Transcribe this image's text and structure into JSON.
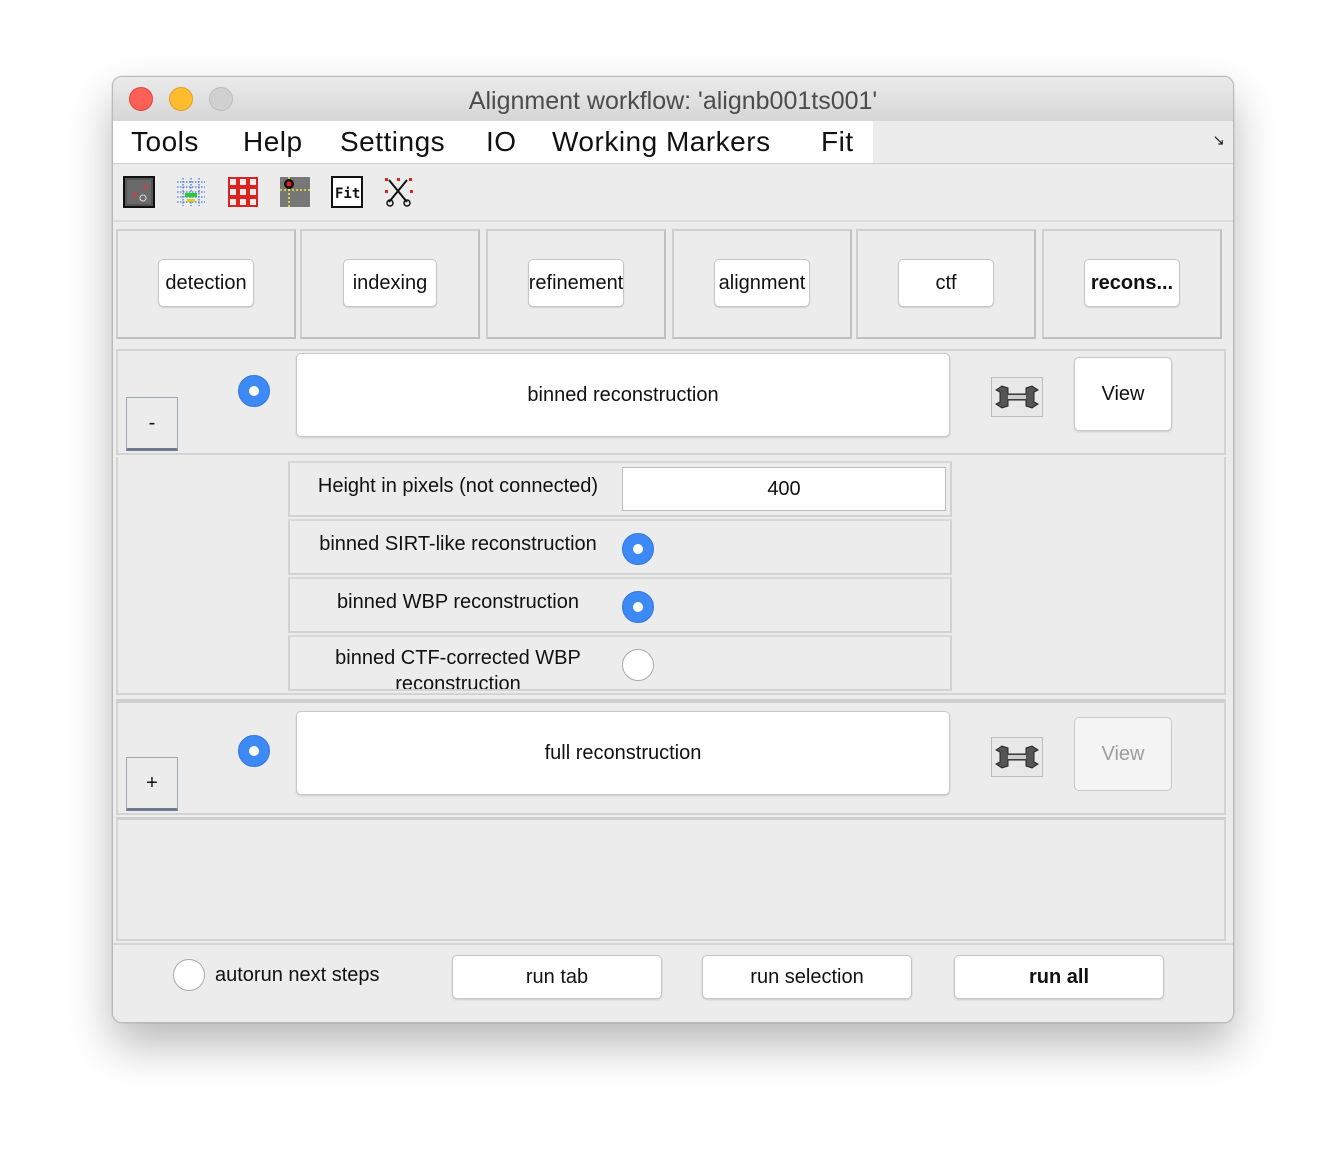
{
  "window": {
    "title": "Alignment workflow: 'alignb001ts001'"
  },
  "menu": {
    "items": [
      "Tools",
      "Help",
      "Settings",
      "IO",
      "Working Markers",
      "Fit"
    ],
    "overflow_icon": "resize-arrow-icon"
  },
  "toolbar": {
    "icons": [
      "marker-image-icon",
      "marker-grid-icon",
      "red-grid-icon",
      "marker-point-icon",
      "fit-icon",
      "scissors-markers-icon"
    ],
    "fit_text": "Fit"
  },
  "tabs": [
    "detection",
    "indexing",
    "refinement",
    "alignment",
    "ctf",
    "recons..."
  ],
  "sections": {
    "binned": {
      "toggle": "-",
      "label": "binned reconstruction",
      "view": "View",
      "selected": true,
      "view_enabled": true
    },
    "full": {
      "toggle": "+",
      "label": "full reconstruction",
      "view": "View",
      "selected": true,
      "view_enabled": false
    }
  },
  "params": {
    "height_label": "Height in pixels (not connected)",
    "height_value": "400",
    "sirt_label": "binned SIRT-like reconstruction",
    "sirt_selected": true,
    "wbp_label": "binned WBP reconstruction",
    "wbp_selected": true,
    "ctf_wbp_label": "binned CTF-corrected WBP reconstruction",
    "ctf_wbp_selected": false
  },
  "footer": {
    "autorun_label": "autorun next steps",
    "autorun_checked": false,
    "run_tab": "run tab",
    "run_selection": "run selection",
    "run_all": "run all"
  },
  "colors": {
    "accent": "#3d8af7",
    "close": "#fe5f57",
    "minimize": "#febc2e",
    "window_bg": "#ececec"
  }
}
